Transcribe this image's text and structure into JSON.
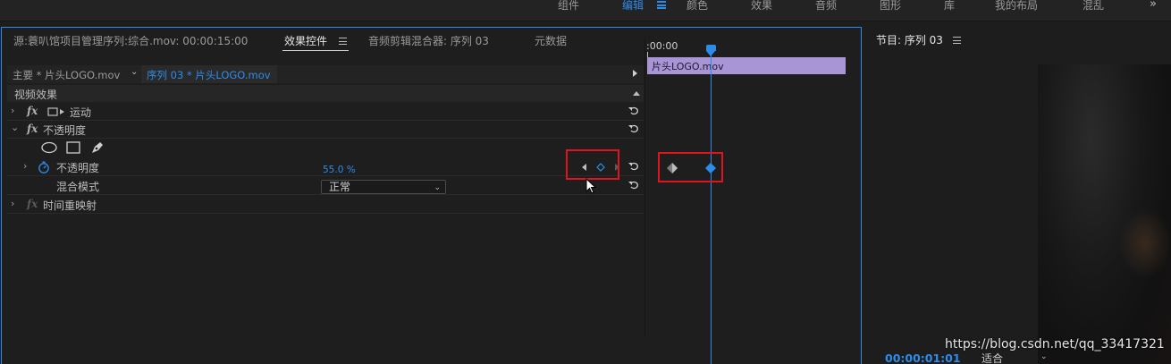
{
  "workspaces": {
    "tabs": [
      "组件",
      "编辑",
      "颜色",
      "效果",
      "音频",
      "图形",
      "库",
      "我的布局",
      "混乱"
    ],
    "active": "编辑",
    "more_icon": "double-chevron-right"
  },
  "effect_controls": {
    "tabs": [
      "源:蓑叭馆项目管理序列:综合.mov: 00:00:15:00",
      "效果控件",
      "音频剪辑混合器: 序列 03",
      "元数据"
    ],
    "active_tab": "效果控件",
    "master_clip": "主要 * 片头LOGO.mov",
    "sequence_clip": "序列 03 * 片头LOGO.mov",
    "section_header": "视频效果",
    "effects": [
      {
        "name": "运动",
        "fx_enabled": true,
        "icon": "motion-transform-icon",
        "expanded": false
      },
      {
        "name": "不透明度",
        "fx_enabled": true,
        "expanded": true
      },
      {
        "name": "时间重映射",
        "fx_enabled": false,
        "expanded": false
      }
    ],
    "mask_tools": [
      "ellipse-mask-icon",
      "rectangle-mask-icon",
      "pen-mask-icon"
    ],
    "opacity": {
      "label": "不透明度",
      "value": "55.0 %"
    },
    "blend_mode": {
      "label": "混合模式",
      "value": "正常"
    }
  },
  "timeline": {
    "timecode": ":00:00",
    "clip_name": "片头LOGO.mov",
    "clip_color": "#a895d6",
    "keyframes": [
      "first-keyframe-inactive",
      "current-keyframe-selected"
    ]
  },
  "program_monitor": {
    "title": "节目: 序列 03",
    "timecode": "00:00:01:01",
    "fit": "适合"
  },
  "watermark": "https://blog.csdn.net/qq_33417321",
  "colors": {
    "accent": "#2d8ceb",
    "highlight_box": "#e0141e",
    "panel_bg": "#1e1e1e"
  }
}
